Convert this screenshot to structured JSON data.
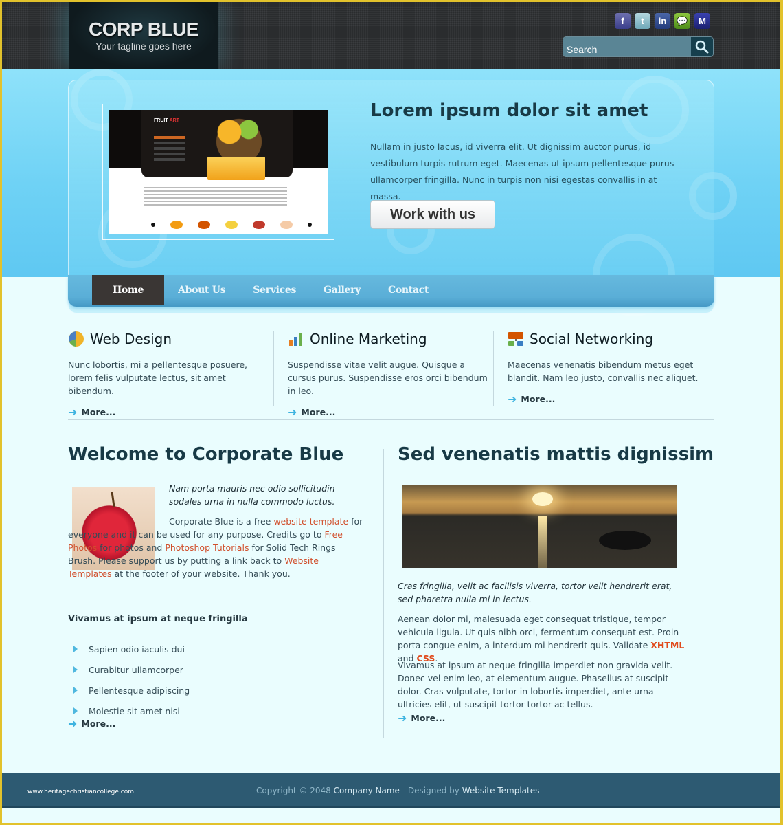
{
  "header": {
    "logo_title": "CORP BLUE",
    "logo_tagline": "Your tagline goes here",
    "social": [
      {
        "name": "facebook-icon",
        "glyph": "f"
      },
      {
        "name": "twitter-icon",
        "glyph": "t"
      },
      {
        "name": "linkedin-icon",
        "glyph": "in"
      },
      {
        "name": "technorati-icon",
        "glyph": "💬"
      },
      {
        "name": "myspace-icon",
        "glyph": "M"
      }
    ],
    "search_placeholder": "Search"
  },
  "hero": {
    "title": "Lorem ipsum dolor sit amet",
    "text": "Nullam in justo lacus, id viverra elit. Ut dignissim auctor purus, id vestibulum turpis rutrum eget. Maecenas ut ipsum pellentesque purus ullamcorper fringilla. Nunc in turpis non nisi egestas convallis in at massa.",
    "button": "Work with us",
    "screenshot": {
      "brand": "FRUIT",
      "brand_accent": "ART"
    }
  },
  "nav": {
    "items": [
      "Home",
      "About Us",
      "Services",
      "Gallery",
      "Contact"
    ],
    "active": "Home"
  },
  "features": [
    {
      "title": "Web Design",
      "text": "Nunc lobortis, mi a pellentesque posuere, lorem felis vulputate lectus, sit amet bibendum.",
      "more": "More..."
    },
    {
      "title": "Online Marketing",
      "text": "Suspendisse vitae velit augue. Quisque a cursus purus. Suspendisse eros orci bibendum in leo.",
      "more": "More..."
    },
    {
      "title": "Social Networking",
      "text": "Maecenas venenatis bibendum metus eget blandit. Nam leo justo, convallis nec aliquet.",
      "more": "More..."
    }
  ],
  "welcome": {
    "title": "Welcome to Corporate Blue",
    "intro": "Nam porta mauris nec odio sollicitudin sodales urna in nulla commodo luctus.",
    "body_1": "Corporate Blue is a free ",
    "link_1": "website template",
    "body_2": " for everyone and it can be used for any purpose. Credits go to ",
    "link_2": "Free Photos",
    "body_3": " for photos and ",
    "link_3": "Photoshop Tutorials",
    "body_4": " for Solid Tech Rings Brush. Please support us by putting a link back to ",
    "link_4": "Website Templates",
    "body_5": " at the footer of your website. Thank you.",
    "list_title": "Vivamus at ipsum at neque fringilla",
    "list": [
      "Sapien odio iaculis dui",
      "Curabitur ullamcorper",
      "Pellentesque adipiscing",
      "Molestie sit amet nisi"
    ],
    "more": "More..."
  },
  "second": {
    "title": "Sed venenatis mattis dignissim",
    "intro": "Cras fringilla, velit ac facilisis viverra, tortor velit hendrerit erat, sed pharetra nulla mi in lectus.",
    "para1_a": "Aenean dolor mi, malesuada eget consequat tristique, tempor vehicula ligula. Ut quis nibh orci, fermentum consequat est. Proin porta congue enim, a interdum mi hendrerit quis. Validate ",
    "xhtml": "XHTML",
    "para1_b": " and ",
    "css": "CSS",
    "para1_c": ".",
    "para2": "Vivamus at ipsum at neque fringilla imperdiet non gravida velit. Donec vel enim leo, at elementum augue. Phasellus at suscipit dolor. Cras vulputate, tortor in lobortis imperdiet, ante urna ultricies elit, ut suscipit tortor tortor ac tellus.",
    "more": "More..."
  },
  "footer": {
    "watermark": "www.heritagechristiancollege.com",
    "copy_prefix": "Copyright © 2048 ",
    "company": "Company Name",
    "designed_by": " - Designed by ",
    "designer": "Website Templates"
  }
}
